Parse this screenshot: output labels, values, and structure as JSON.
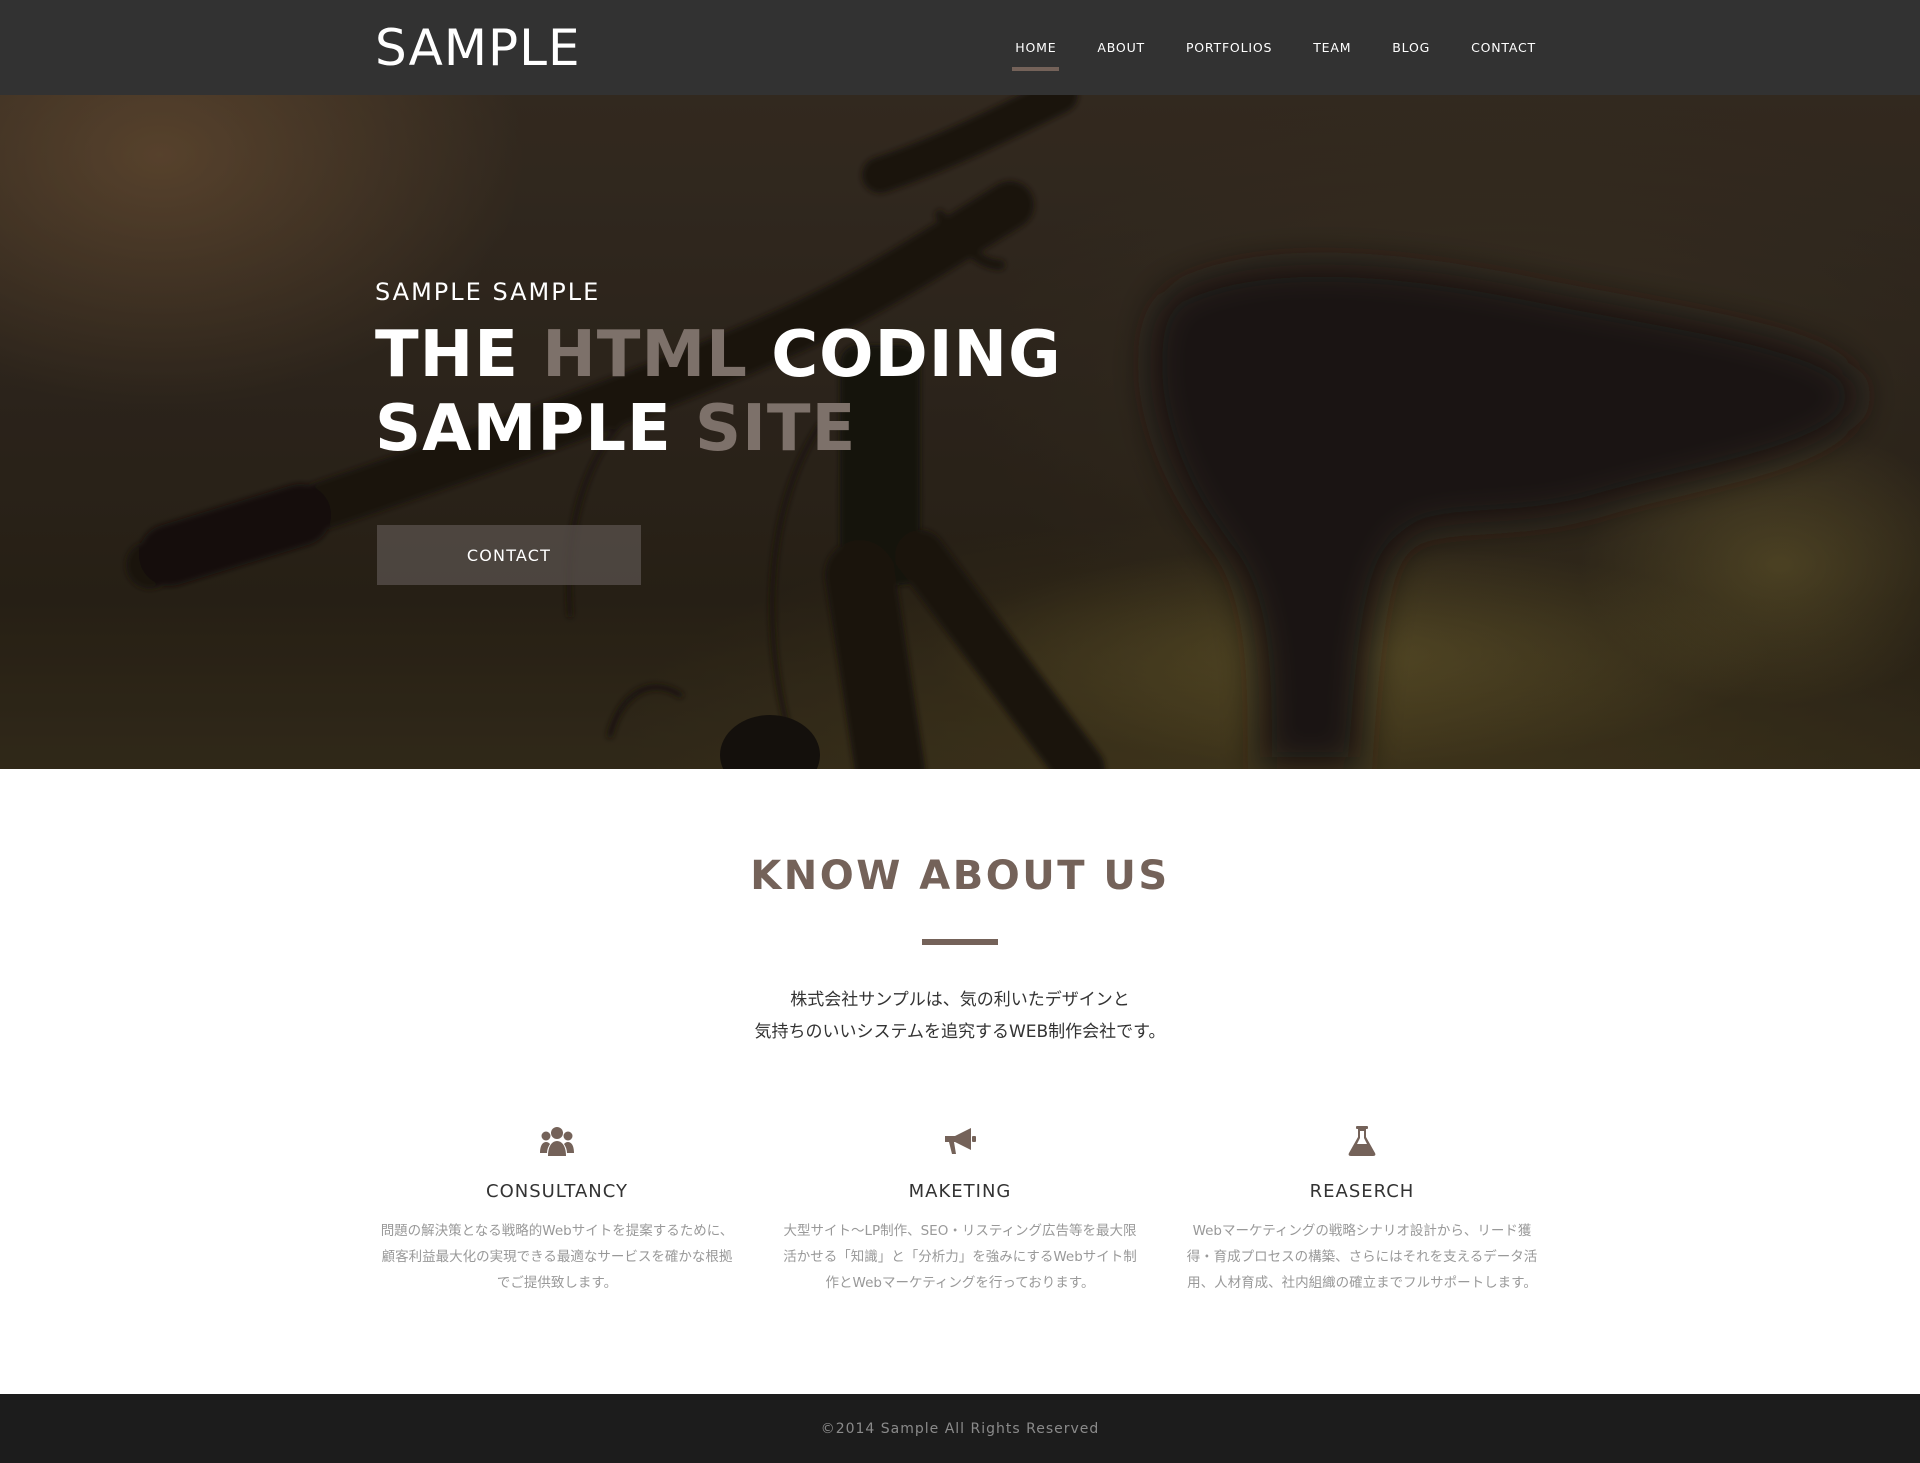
{
  "header": {
    "logo": "SAMPLE",
    "nav": [
      {
        "label": "HOME",
        "active": true
      },
      {
        "label": "ABOUT",
        "active": false
      },
      {
        "label": "PORTFOLIOS",
        "active": false
      },
      {
        "label": "TEAM",
        "active": false
      },
      {
        "label": "BLOG",
        "active": false
      },
      {
        "label": "CONTACT",
        "active": false
      }
    ]
  },
  "hero": {
    "subtitle": "SAMPLE SAMPLE",
    "title_part1": "THE ",
    "title_part2": "HTML",
    "title_part3": " CODING",
    "title_part4": "SAMPLE ",
    "title_part5": "SITE",
    "button_label": "CONTACT"
  },
  "about": {
    "title": "KNOW ABOUT US",
    "text_line1": "株式会社サンプルは、気の利いたデザインと",
    "text_line2": "気持ちのいいシステムを追究するWEB制作会社です。",
    "services": [
      {
        "icon": "users-icon",
        "name": "CONSULTANCY",
        "desc": "問題の解決策となる戦略的Webサイトを提案するために、顧客利益最大化の実現できる最適なサービスを確かな根拠でご提供致します。"
      },
      {
        "icon": "megaphone-icon",
        "name": "MAKETING",
        "desc": "大型サイト〜LP制作、SEO・リスティング広告等を最大限活かせる「知識」と「分析力」を強みにするWebサイト制作とWebマーケティングを行っております。"
      },
      {
        "icon": "flask-icon",
        "name": "REASERCH",
        "desc": "Webマーケティングの戦略シナリオ設計から、リード獲得・育成プロセスの構築、さらにはそれを支えるデータ活用、人材育成、社内組織の確立までフルサポートします。"
      }
    ]
  },
  "footer": {
    "copyright": "©2014 Sample All Rights Reserved"
  },
  "colors": {
    "accent": "#746259",
    "header_bg": "#323232",
    "footer_bg": "#1c1c1c"
  }
}
